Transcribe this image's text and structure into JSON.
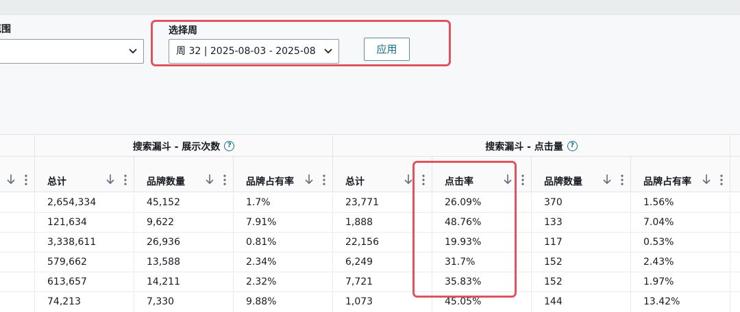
{
  "filters": {
    "range_label_fragment": "范围",
    "range_value": "",
    "week_label": "选择周",
    "week_value": "周 32 | 2025-08-03 - 2025-08",
    "apply_label": "应用"
  },
  "table": {
    "groups": [
      {
        "title": "搜索漏斗 - 展示次数"
      },
      {
        "title": "搜索漏斗 - 点击量"
      }
    ],
    "columns": [
      "总计",
      "品牌数量",
      "品牌占有率",
      "总计",
      "点击率",
      "品牌数量",
      "品牌占有率"
    ],
    "rows": [
      [
        "2,654,334",
        "45,152",
        "1.7%",
        "23,771",
        "26.09%",
        "370",
        "1.56%"
      ],
      [
        "121,634",
        "9,622",
        "7.91%",
        "1,888",
        "48.76%",
        "133",
        "7.04%"
      ],
      [
        "3,338,611",
        "26,936",
        "0.81%",
        "22,156",
        "19.93%",
        "117",
        "0.53%"
      ],
      [
        "579,662",
        "13,588",
        "2.34%",
        "6,249",
        "31.7%",
        "152",
        "2.43%"
      ],
      [
        "613,657",
        "14,211",
        "2.32%",
        "7,721",
        "35.83%",
        "152",
        "1.97%"
      ],
      [
        "74,213",
        "7,330",
        "9.88%",
        "1,073",
        "45.05%",
        "144",
        "13.42%"
      ]
    ]
  },
  "colors": {
    "highlight": "#e0535c",
    "accent": "#0f6e85"
  }
}
